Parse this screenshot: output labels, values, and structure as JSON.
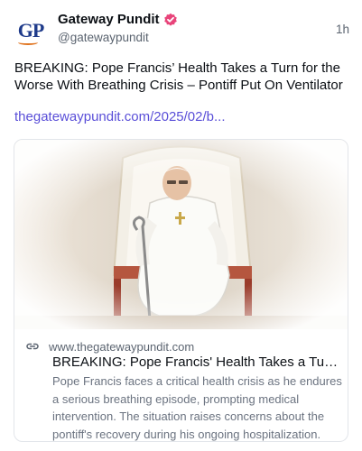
{
  "account": {
    "avatar_text": "GP",
    "display_name": "Gateway Pundit",
    "handle": "@gatewaypundit",
    "time_ago": "1h",
    "verified_color": "#e8447a"
  },
  "post": {
    "text": "BREAKING: Pope Francis’ Health Takes a Turn for the Worse With Breathing Crisis – Pontiff Put On Ventilator",
    "link": "thegatewaypundit.com/2025/02/b..."
  },
  "card": {
    "image_icon": "photo-pope-in-chair",
    "link_icon": "link-icon",
    "domain": "www.thegatewaypundit.com",
    "title": "BREAKING: Pope Francis' Health Takes a Turn f...",
    "description": "Pope Francis faces a critical health crisis as he endures a serious breathing episode, prompting medical intervention. The situation raises concerns about the pontiff's recovery during his ongoing hospitalization."
  },
  "colors": {
    "link": "#5a4fd8",
    "muted": "#5b6470",
    "brand_blue": "#1e3a8a",
    "brand_orange": "#e0741f"
  }
}
